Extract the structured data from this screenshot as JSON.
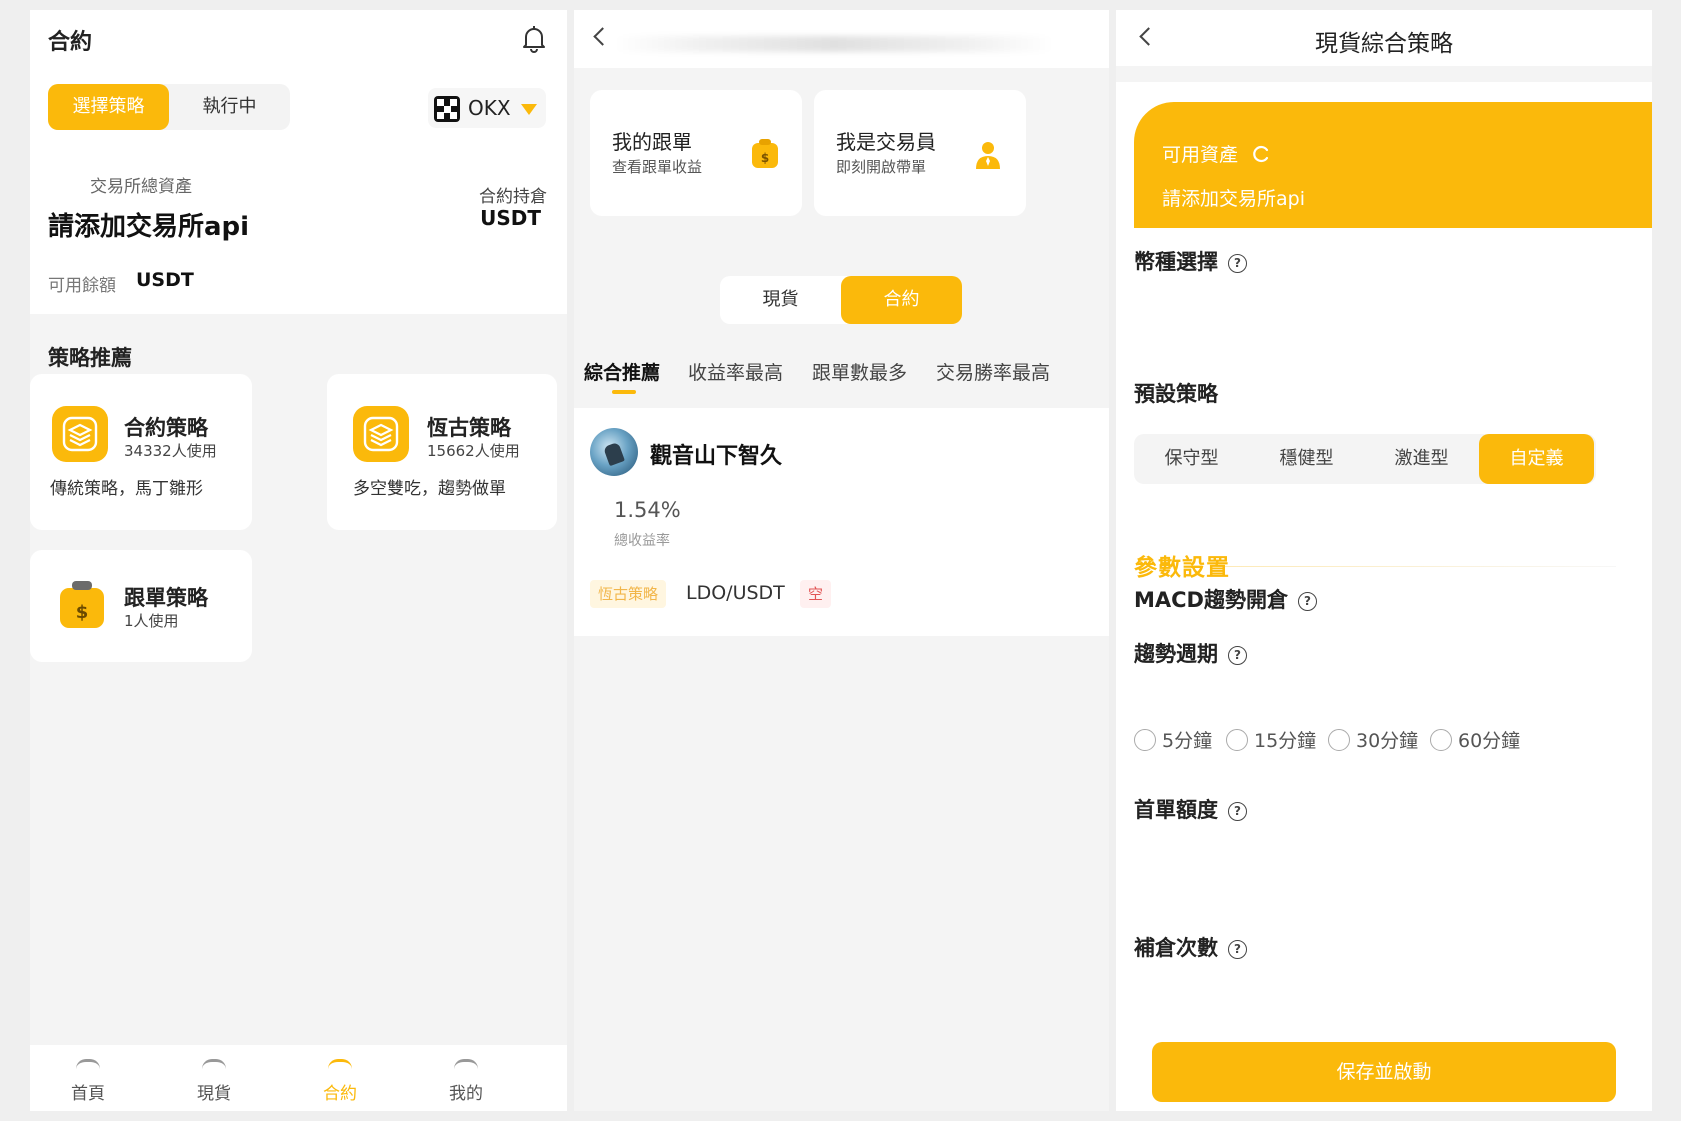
{
  "screen1": {
    "title": "合約",
    "segment": {
      "active": "選擇策略",
      "inactive": "執行中"
    },
    "exchange": {
      "name": "OKX"
    },
    "assets_label": "交易所總資產",
    "api_prompt": "請添加交易所api",
    "holdings": {
      "label": "合約持倉",
      "unit": "USDT"
    },
    "balance": {
      "label": "可用餘額",
      "unit": "USDT"
    },
    "section_title": "策略推薦",
    "strategies": [
      {
        "name": "合約策略",
        "users": "34332人使用",
        "desc": "傳統策略，馬丁雛形"
      },
      {
        "name": "恆古策略",
        "users": "15662人使用",
        "desc": "多空雙吃，趨勢做單"
      },
      {
        "name": "跟單策略",
        "users": "1人使用"
      }
    ],
    "nav": [
      {
        "label": "首頁"
      },
      {
        "label": "現貨"
      },
      {
        "label": "合約"
      },
      {
        "label": "我的"
      }
    ]
  },
  "screen2": {
    "cards": [
      {
        "title": "我的跟單",
        "subtitle": "查看跟單收益"
      },
      {
        "title": "我是交易員",
        "subtitle": "即刻開啟帶單"
      }
    ],
    "segment": {
      "inactive": "現貨",
      "active": "合約"
    },
    "tabs": [
      "綜合推薦",
      "收益率最高",
      "跟單數最多",
      "交易勝率最高"
    ],
    "trader": {
      "name": "觀音山下智久",
      "return_value": "1.54%",
      "return_label": "總收益率",
      "strategy_tag": "恆古策略",
      "pair": "LDO/USDT",
      "side": "空"
    }
  },
  "screen3": {
    "title": "現貨綜合策略",
    "asset_label": "可用資產",
    "asset_prompt": "請添加交易所api",
    "coin_select": "幣種選擇",
    "preset_title": "預設策略",
    "presets": [
      "保守型",
      "穩健型",
      "激進型",
      "自定義"
    ],
    "param_title": "參數設置",
    "macd": "MACD趨勢開倉",
    "period_title": "趨勢週期",
    "periods": [
      "5分鐘",
      "15分鐘",
      "30分鐘",
      "60分鐘"
    ],
    "first_amount": "首單額度",
    "refill_count": "補倉次數",
    "save_label": "保存並啟動"
  },
  "colors": {
    "accent": "#fbb90b",
    "short": "#e25454"
  }
}
